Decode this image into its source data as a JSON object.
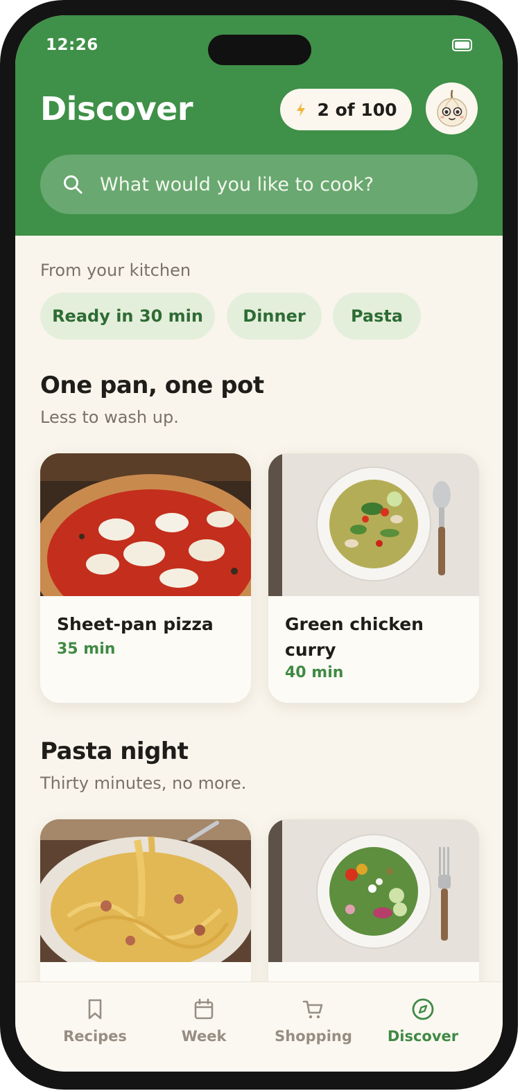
{
  "status_bar": {
    "time": "12:26"
  },
  "header": {
    "title": "Discover",
    "quota": "2 of 100",
    "search_placeholder": "What would you like to cook?"
  },
  "kitchen": {
    "label": "From your kitchen",
    "chips": [
      "Ready in 30 min",
      "Dinner",
      "Pasta"
    ]
  },
  "sections": [
    {
      "title": "One pan, one pot",
      "subtitle": "Less to wash up.",
      "recipes": [
        {
          "name": "Sheet-pan pizza",
          "time": "35 min"
        },
        {
          "name": "Green chicken curry",
          "time": "40 min"
        }
      ]
    },
    {
      "title": "Pasta night",
      "subtitle": "Thirty minutes, no more.",
      "recipes": [
        {
          "name": "",
          "time": ""
        },
        {
          "name": "",
          "time": ""
        }
      ]
    }
  ],
  "tabs": [
    {
      "label": "Recipes",
      "icon": "bookmark-icon",
      "active": false
    },
    {
      "label": "Week",
      "icon": "calendar-icon",
      "active": false
    },
    {
      "label": "Shopping",
      "icon": "cart-icon",
      "active": false
    },
    {
      "label": "Discover",
      "icon": "compass-icon",
      "active": true
    }
  ],
  "colors": {
    "brand_green": "#3f9048",
    "background": "#f9f5ec",
    "chip_background": "#e4efdb",
    "accent_text": "#3f8a44"
  }
}
